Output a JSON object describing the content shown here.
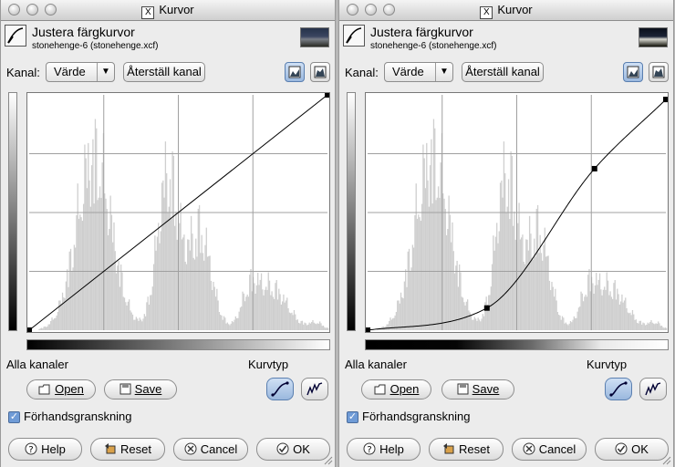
{
  "windows": [
    {
      "window_title": "Kurvor",
      "header_title": "Justera färgkurvor",
      "header_subtitle": "stonehenge-6 (stonehenge.xcf)",
      "kanal_label": "Kanal:",
      "channel_value": "Värde",
      "reset_channel_label": "Återställ kanal",
      "all_channels_label": "Alla kanaler",
      "curve_type_label": "Kurvtyp",
      "open_label": "Open",
      "save_label": "Save",
      "preview_label": "Förhandsgranskning",
      "preview_checked": true,
      "help_label": "Help",
      "reset_label": "Reset",
      "cancel_label": "Cancel",
      "ok_label": "OK",
      "curve_type": "smooth",
      "curve_points": [
        [
          0,
          0
        ],
        [
          255,
          255
        ]
      ]
    },
    {
      "window_title": "Kurvor",
      "header_title": "Justera färgkurvor",
      "header_subtitle": "stonehenge-6 (stonehenge.xcf)",
      "kanal_label": "Kanal:",
      "channel_value": "Värde",
      "reset_channel_label": "Återställ kanal",
      "all_channels_label": "Alla kanaler",
      "curve_type_label": "Kurvtyp",
      "open_label": "Open",
      "save_label": "Save",
      "preview_label": "Förhandsgranskning",
      "preview_checked": true,
      "help_label": "Help",
      "reset_label": "Reset",
      "cancel_label": "Cancel",
      "ok_label": "OK",
      "curve_type": "smooth",
      "curve_points": [
        [
          0,
          0
        ],
        [
          102,
          24
        ],
        [
          194,
          175
        ],
        [
          255,
          250
        ]
      ]
    }
  ],
  "histogram": {
    "color": "#cfcfcf",
    "peaks": [
      {
        "center": 55,
        "width": 15,
        "height": 0.97
      },
      {
        "center": 118,
        "width": 9,
        "height": 0.86
      },
      {
        "center": 145,
        "width": 10,
        "height": 0.55
      },
      {
        "center": 188,
        "width": 7,
        "height": 0.16
      },
      {
        "center": 206,
        "width": 14,
        "height": 0.24
      },
      {
        "center": 245,
        "width": 6,
        "height": 0.04
      }
    ]
  }
}
